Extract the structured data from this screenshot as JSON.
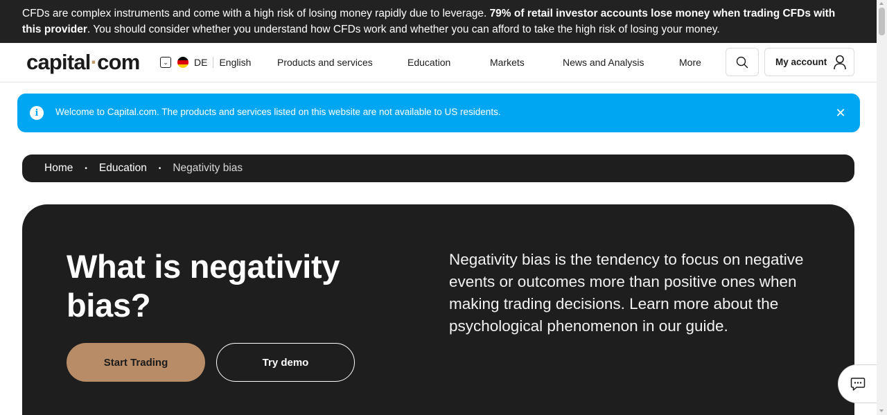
{
  "risk_warning": {
    "text_start": "CFDs are complex instruments and come with a high risk of losing money rapidly due to leverage. ",
    "text_bold": "79% of retail investor accounts lose money when trading CFDs with this provider",
    "text_end": ". You should consider whether you understand how CFDs work and whether you can afford to take the high risk of losing your money."
  },
  "header": {
    "logo_part1": "capital",
    "logo_dot": "·",
    "logo_part2": "com",
    "region": "DE",
    "language": "English",
    "nav": [
      {
        "label": "Products and services"
      },
      {
        "label": "Education"
      },
      {
        "label": "Markets"
      },
      {
        "label": "News and Analysis"
      },
      {
        "label": "More"
      }
    ],
    "account_label": "My account"
  },
  "notice": {
    "icon": "info-icon",
    "message": "Welcome to Capital.com. The products and services listed on this website are not available to US residents.",
    "close_symbol": "✕"
  },
  "breadcrumb": {
    "items": [
      "Home",
      "Education",
      "Negativity bias"
    ],
    "separator": "•"
  },
  "hero": {
    "title": "What is negativity bias?",
    "primary_button": "Start Trading",
    "secondary_button": "Try demo",
    "description": "Negativity bias is the tendency to focus on negative events or outcomes more than positive ones when making trading decisions. Learn more about the psychological phenomenon in our guide."
  },
  "colors": {
    "dark": "#1e1e1e",
    "accent_gold": "#b88c66",
    "notice_blue": "#00a6f2",
    "flag_de": [
      "#000000",
      "#dd0000",
      "#ffce00"
    ]
  }
}
